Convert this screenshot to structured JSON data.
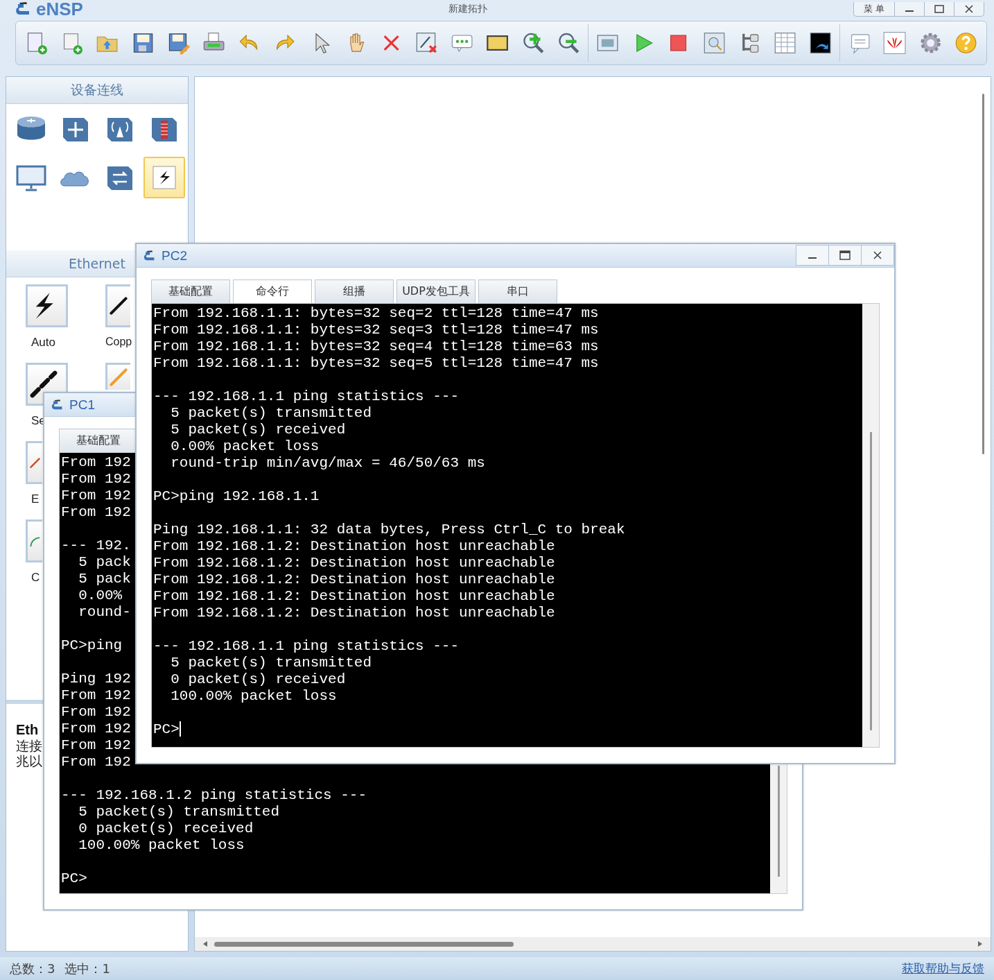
{
  "app": {
    "logo": "eNSP",
    "title": "新建拓扑",
    "menu": "菜 单"
  },
  "device_panel": {
    "title": "设备连线",
    "devices": [
      {
        "kind": "router",
        "selected": false
      },
      {
        "kind": "switch",
        "selected": false
      },
      {
        "kind": "wireless",
        "selected": false
      },
      {
        "kind": "firewall",
        "selected": false
      },
      {
        "kind": "pc",
        "selected": false
      },
      {
        "kind": "cloud",
        "selected": false
      },
      {
        "kind": "hub",
        "selected": false
      },
      {
        "kind": "link",
        "selected": true
      }
    ]
  },
  "cable_panel": {
    "title": "Ethernet",
    "columns": [
      [
        {
          "kind": "auto",
          "label": "Auto"
        },
        {
          "kind": "serial",
          "label": "Se"
        },
        {
          "kind": "red",
          "label": "E"
        },
        {
          "kind": "green",
          "label": "C"
        }
      ],
      [
        {
          "kind": "copper",
          "label": "Copp"
        },
        {
          "kind": "orange"
        }
      ]
    ]
  },
  "info": {
    "title": "Eth",
    "lines": [
      "连接",
      "兆以"
    ]
  },
  "windows": [
    {
      "title": "PC1",
      "controls": false,
      "cursor": false,
      "tabs": [
        {
          "label": "基础配置",
          "selected": false
        }
      ],
      "blocks": [
        [
          "From 192",
          "From 192",
          "From 192",
          "From 192"
        ],
        [
          "--- 192.",
          "  5 pack",
          "  5 pack",
          "  0.00%",
          "  round-"
        ],
        [
          "PC>ping"
        ],
        [
          "Ping 192",
          "From 192",
          "From 192",
          "From 192",
          "From 192",
          "From 192"
        ],
        [
          "--- 192.168.1.2 ping statistics ---",
          "  5 packet(s) transmitted",
          "  0 packet(s) received",
          "  100.00% packet loss"
        ],
        [
          "PC>"
        ]
      ]
    },
    {
      "title": "PC2",
      "controls": true,
      "cursor": true,
      "tabs": [
        {
          "label": "基础配置",
          "selected": false
        },
        {
          "label": "命令行",
          "selected": true
        },
        {
          "label": "组播",
          "selected": false
        },
        {
          "label": "UDP发包工具",
          "selected": false
        },
        {
          "label": "串口",
          "selected": false
        }
      ],
      "blocks": [
        [
          "From 192.168.1.1: bytes=32 seq=2 ttl=128 time=47 ms",
          "From 192.168.1.1: bytes=32 seq=3 ttl=128 time=47 ms",
          "From 192.168.1.1: bytes=32 seq=4 ttl=128 time=63 ms",
          "From 192.168.1.1: bytes=32 seq=5 ttl=128 time=47 ms"
        ],
        [
          "--- 192.168.1.1 ping statistics ---",
          "  5 packet(s) transmitted",
          "  5 packet(s) received",
          "  0.00% packet loss",
          "  round-trip min/avg/max = 46/50/63 ms"
        ],
        [
          "PC>ping 192.168.1.1"
        ],
        [
          "Ping 192.168.1.1: 32 data bytes, Press Ctrl_C to break",
          "From 192.168.1.2: Destination host unreachable",
          "From 192.168.1.2: Destination host unreachable",
          "From 192.168.1.2: Destination host unreachable",
          "From 192.168.1.2: Destination host unreachable",
          "From 192.168.1.2: Destination host unreachable"
        ],
        [
          "--- 192.168.1.1 ping statistics ---",
          "  5 packet(s) transmitted",
          "  0 packet(s) received",
          "  100.00% packet loss"
        ],
        [
          "PC>"
        ]
      ]
    }
  ],
  "status_bar": {
    "total": "总数：3",
    "selected": "选中：1",
    "help": "获取帮助与反馈"
  }
}
